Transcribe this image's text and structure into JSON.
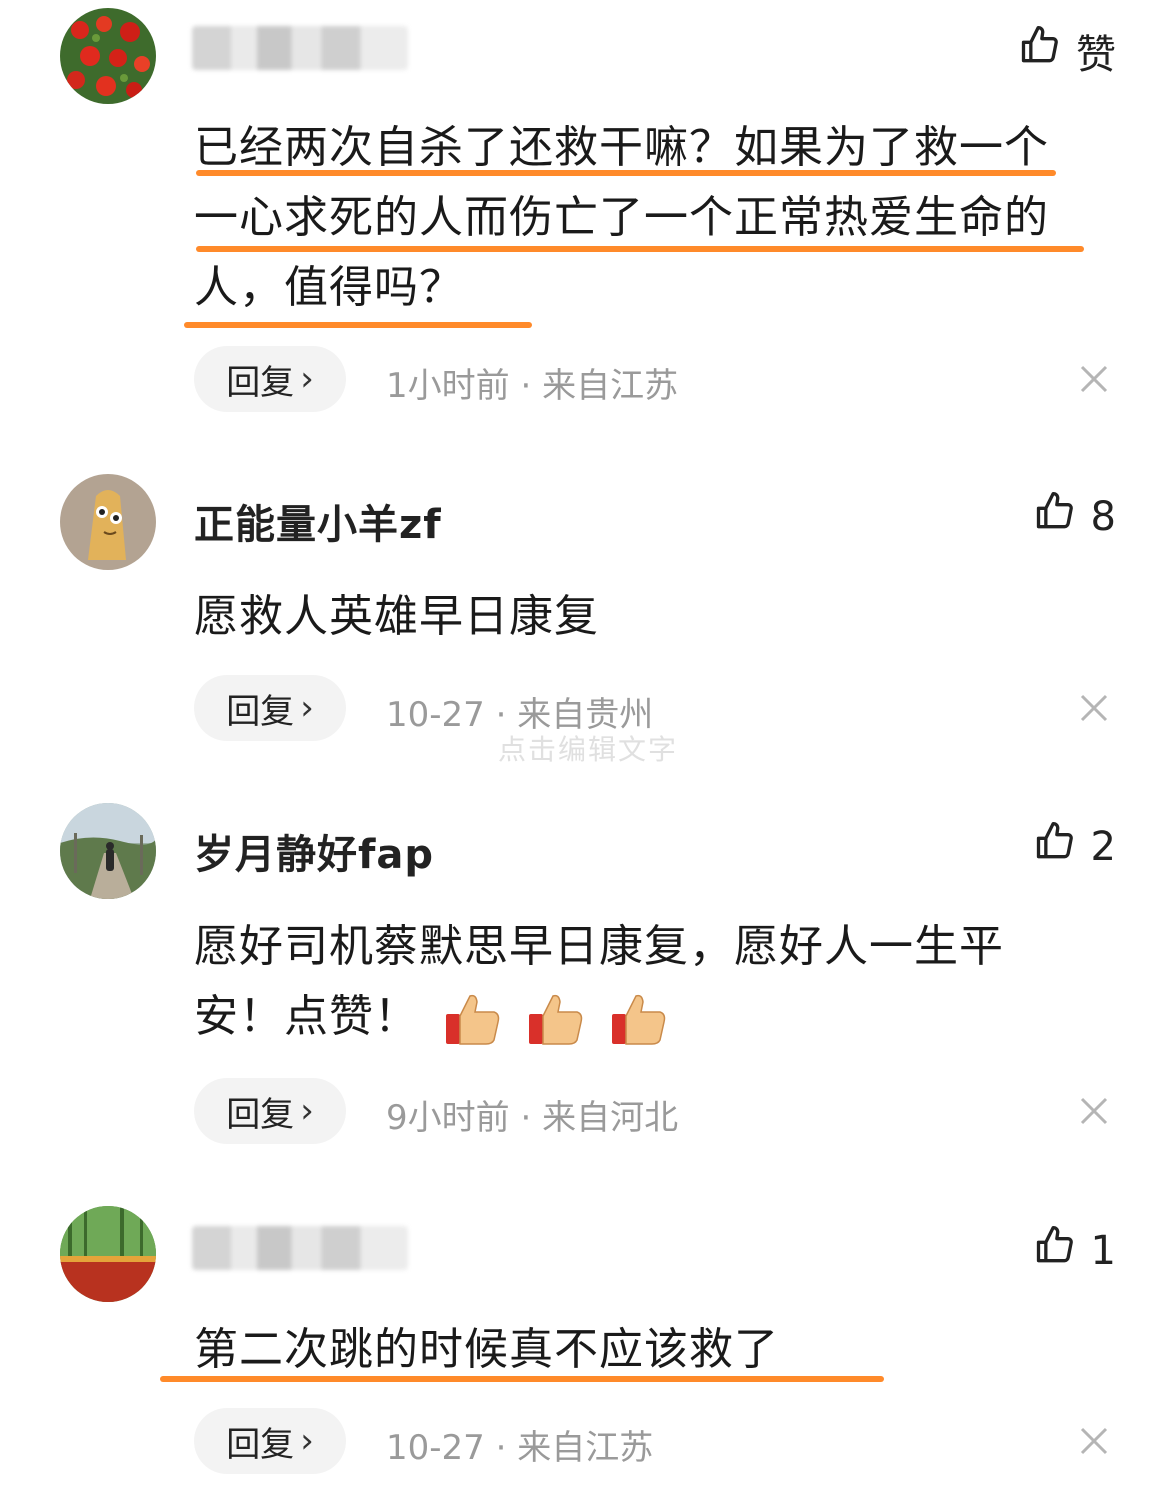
{
  "comments": [
    {
      "name": "",
      "name_obscured": true,
      "like_label": "赞",
      "text_lines": [
        "已经两次自杀了还救干嘛？如果为了救一个",
        "一心求死的人而伤亡了一个正常热爱生命的",
        "人，值得吗？"
      ],
      "reply_label": "回复",
      "time": "1小时前",
      "location": "来自江苏",
      "avatar": "red-flowers"
    },
    {
      "name": "正能量小羊zf",
      "like_label": "8",
      "text_lines": [
        "愿救人英雄早日康复"
      ],
      "reply_label": "回复",
      "time": "10-27",
      "location": "来自贵州",
      "avatar": "cartoon-face"
    },
    {
      "name": "岁月静好fap",
      "like_label": "2",
      "text_lines": [
        "愿好司机蔡默思早日康复，愿好人一生平",
        "安！点赞！"
      ],
      "emojis": [
        "thumbs-up-emoji",
        "thumbs-up-emoji",
        "thumbs-up-emoji"
      ],
      "reply_label": "回复",
      "time": "9小时前",
      "location": "来自河北",
      "avatar": "person-on-road"
    },
    {
      "name": "",
      "name_obscured": true,
      "like_label": "1",
      "text_lines": [
        "第二次跳的时候真不应该救了"
      ],
      "reply_label": "回复",
      "time": "10-27",
      "location": "来自江苏",
      "avatar": "bamboo-wall"
    }
  ],
  "separator": " · ",
  "watermark": "点击编辑文字",
  "colors": {
    "highlight": "#ff8a2a",
    "meta": "#9a9a9a",
    "reply_bg": "#f3f3f3"
  }
}
